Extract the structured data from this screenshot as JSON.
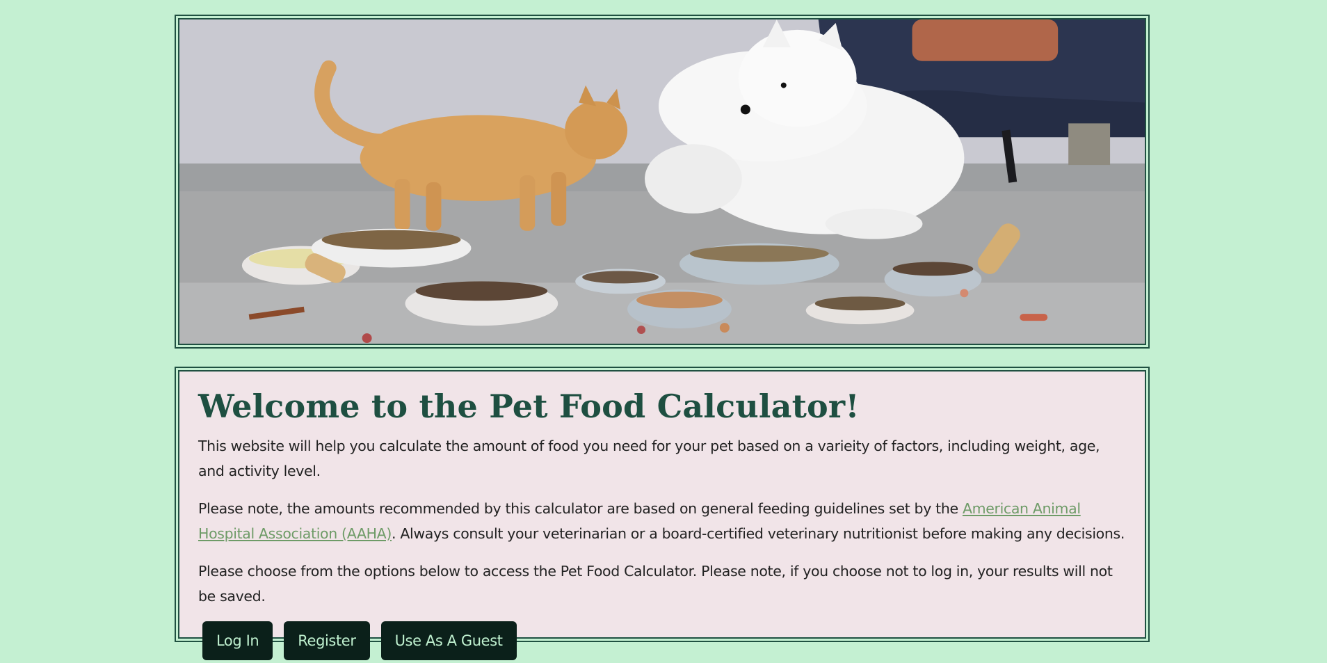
{
  "hero": {
    "image_alt": "Orange cat and white dog nuzzling beside bowls of pet food",
    "icon": "pet-photo-illustration"
  },
  "content": {
    "title": "Welcome to the Pet Food Calculator!",
    "intro": "This website will help you calculate the amount of food you need for your pet based on a varieity of factors, including weight, age, and activity level.",
    "note_before_link": "Please note, the amounts recommended by this calculator are based on general feeding guidelines set by the ",
    "link_text": "American Animal Hospital Association (AAHA)",
    "note_after_link": ". Always consult your veterinarian or a board-certified veterinary nutritionist before making any decisions.",
    "choose_text": "Please choose from the options below to access the Pet Food Calculator. Please note, if you choose not to log in, your results will not be saved."
  },
  "buttons": {
    "login": "Log In",
    "register": "Register",
    "guest": "Use As A Guest"
  },
  "colors": {
    "page_background": "#c4f0d2",
    "panel_background": "#f1e4e8",
    "border": "#1f5041",
    "title": "#1e4f41",
    "link": "#6e9b67",
    "button_background": "#0b201a",
    "button_text": "#bff0cf"
  }
}
